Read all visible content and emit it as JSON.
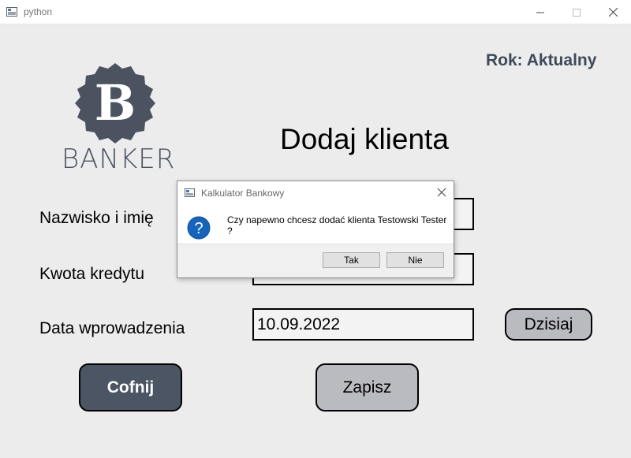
{
  "window": {
    "title": "python",
    "icon": "app-window-icon"
  },
  "header": {
    "year_label": "Rok: Aktualny"
  },
  "logo": {
    "letter": "B",
    "brand": "BANKER"
  },
  "form": {
    "heading": "Dodaj klienta",
    "name_label": "Nazwisko i imię",
    "name_value": "",
    "amount_label": "Kwota kredytu",
    "amount_value": "",
    "date_label": "Data wprowadzenia",
    "date_value": "10.09.2022",
    "today_button": "Dzisiaj"
  },
  "actions": {
    "back": "Cofnij",
    "save": "Zapisz"
  },
  "dialog": {
    "title": "Kalkulator Bankowy",
    "message": "Czy napewno chcesz dodać klienta Testowski Tester ?",
    "yes": "Tak",
    "no": "Nie",
    "icon": "question-icon"
  },
  "colors": {
    "accent": "#4b5564",
    "button_gray": "#babac1",
    "question_blue": "#1565c0"
  }
}
